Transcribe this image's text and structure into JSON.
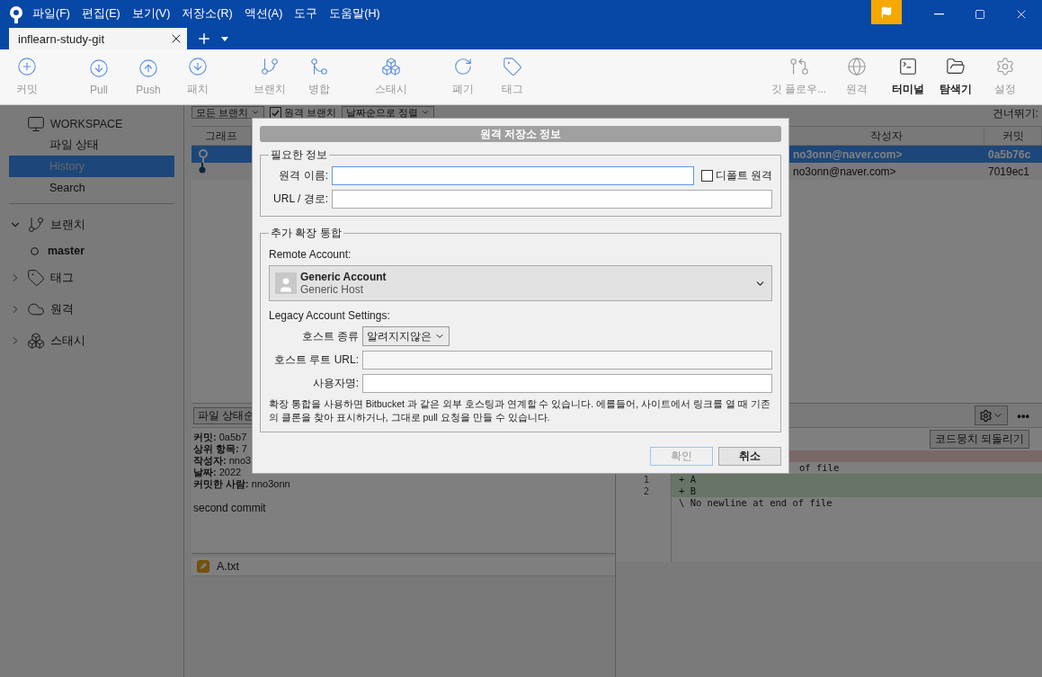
{
  "window": {
    "menu": [
      "파일(F)",
      "편집(E)",
      "보기(V)",
      "저장소(R)",
      "액션(A)",
      "도구",
      "도움말(H)"
    ]
  },
  "tabs": [
    {
      "label": "inflearn-study-git",
      "selected": true
    }
  ],
  "toolbar": {
    "left": [
      {
        "label": "커밋",
        "enabled": false
      },
      {
        "label": "Pull",
        "enabled": false
      },
      {
        "label": "Push",
        "enabled": false
      },
      {
        "label": "패치",
        "enabled": false
      },
      {
        "label": "브랜치",
        "enabled": false
      },
      {
        "label": "병합",
        "enabled": false
      },
      {
        "label": "스태시",
        "enabled": false
      },
      {
        "label": "폐기",
        "enabled": false
      },
      {
        "label": "태그",
        "enabled": false
      }
    ],
    "right": [
      {
        "label": "깃 플로우...",
        "enabled": false
      },
      {
        "label": "원격",
        "enabled": false
      },
      {
        "label": "터미널",
        "enabled": true
      },
      {
        "label": "탐색기",
        "enabled": true
      },
      {
        "label": "설정",
        "enabled": false
      }
    ]
  },
  "sidebar": {
    "workspace": {
      "title": "WORKSPACE",
      "items": [
        {
          "label": "파일 상태",
          "selected": false
        },
        {
          "label": "History",
          "selected": true
        },
        {
          "label": "Search",
          "selected": false
        }
      ]
    },
    "sections": [
      {
        "label": "브랜치",
        "expanded": true,
        "children": [
          {
            "label": "master"
          }
        ]
      },
      {
        "label": "태그",
        "expanded": false
      },
      {
        "label": "원격",
        "expanded": false
      },
      {
        "label": "스태시",
        "expanded": false
      }
    ]
  },
  "filter_bar": {
    "branches": "모든 브랜치",
    "remote_branches": {
      "label": "원격 브랜치",
      "checked": true
    },
    "sort": "날짜순으로 정렬",
    "skip_label": "건너뛰기:"
  },
  "table": {
    "columns": [
      "그래프",
      "작성자",
      "커밋"
    ],
    "rows": [
      {
        "author": "no3onn@naver.com>",
        "commit": "0a5b76c",
        "selected": true
      },
      {
        "author": "no3onn@naver.com>",
        "commit": "7019ec1",
        "selected": false
      }
    ]
  },
  "details": {
    "sort": "파일 상태순",
    "lines": [
      "**커밋:** 0a5b7",
      "**상위 항목:** 7",
      "**작성자:** nno3",
      "**날짜:** 2022",
      "**커밋한 사람:** nno3onn"
    ],
    "message": "second commit",
    "files": [
      {
        "name": "A.txt"
      }
    ]
  },
  "diff": {
    "more": "•••",
    "revert": "코드뭉치 되돌리기",
    "lines": [
      {
        "kind": "removed"
      },
      {
        "kind": "partial",
        "text": "of file"
      },
      {
        "kind": "added",
        "number": "1",
        "text": "+ A"
      },
      {
        "kind": "added",
        "number": "2",
        "text": "+ B"
      },
      {
        "kind": "context",
        "text": "\\ No newline at end of file"
      }
    ]
  },
  "dialog": {
    "title": "원격 저장소 정보",
    "required": {
      "legend": "필요한 정보",
      "name_label": "원격 이름:",
      "default_remote": {
        "label": "디폴트 원격",
        "checked": false
      },
      "url_label": "URL / 경로:"
    },
    "integration": {
      "legend": "추가 확장 통합",
      "account_label": "Remote Account:",
      "account": {
        "name": "Generic Account",
        "host": "Generic Host"
      },
      "legacy_label": "Legacy Account Settings:",
      "host_type_label": "호스트 종류",
      "host_type": "알려지지않은",
      "host_root_label": "호스트 루트 URL:",
      "username_label": "사용자명:",
      "note": "확장 통합을 사용하면 Bitbucket 과 같은 외부 호스팅과 연계할 수 있습니다. 에를들어, 사이트에서 링크를 열 때 기존의 클론을 찾아 표시하거나, 그대로 pull 요청을 만들 수 있습니다."
    },
    "buttons": [
      {
        "label": "확인",
        "disabled": true
      },
      {
        "label": "취소",
        "disabled": false
      }
    ]
  }
}
